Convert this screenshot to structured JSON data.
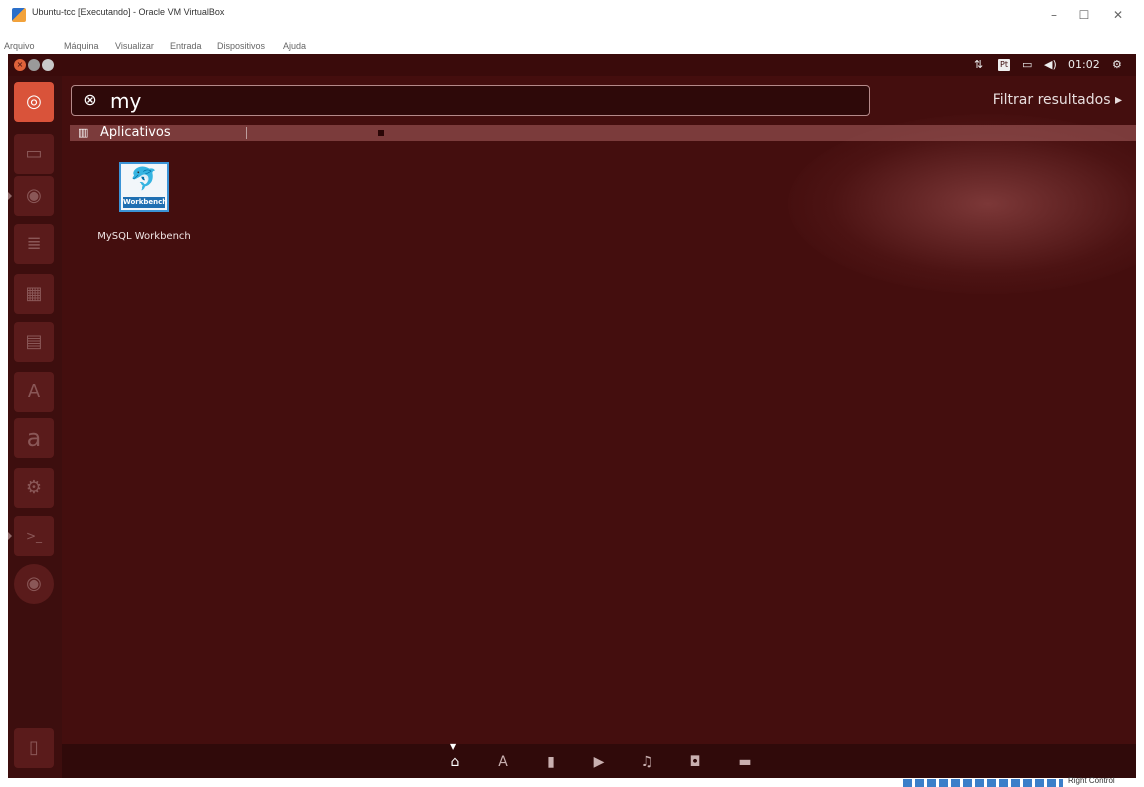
{
  "window": {
    "title": "Ubuntu-tcc [Executando] - Oracle VM VirtualBox",
    "controls": {
      "minimize": "–",
      "maximize": "☐",
      "close": "✕"
    }
  },
  "menu": [
    "Arquivo",
    "Máquina",
    "Visualizar",
    "Entrada",
    "Dispositivos",
    "Ajuda"
  ],
  "top_panel": {
    "keyboard_layout": "Pt",
    "time": "01:02",
    "icons": [
      "network-arrows-icon",
      "keyboard-layout-icon",
      "battery-icon",
      "volume-icon",
      "system-gear-icon"
    ]
  },
  "launcher": {
    "items": [
      {
        "name": "ubuntu-dash-icon",
        "glyph": "◎",
        "active": true
      },
      {
        "name": "files-icon",
        "glyph": "▭"
      },
      {
        "name": "firefox-icon",
        "glyph": "◉"
      },
      {
        "name": "libreoffice-writer-icon",
        "glyph": "≣"
      },
      {
        "name": "libreoffice-calc-icon",
        "glyph": "▦"
      },
      {
        "name": "libreoffice-impress-icon",
        "glyph": "▤"
      },
      {
        "name": "software-center-icon",
        "glyph": "A"
      },
      {
        "name": "amazon-icon",
        "glyph": "a"
      },
      {
        "name": "system-settings-icon",
        "glyph": "⚙"
      },
      {
        "name": "terminal-icon",
        "glyph": ">_"
      },
      {
        "name": "dvd-icon",
        "glyph": "◉"
      },
      {
        "name": "trash-icon",
        "glyph": "▯"
      }
    ]
  },
  "dash": {
    "search_query": "my",
    "clear_glyph": "⊗",
    "filter_label": "Filtrar resultados",
    "filter_arrow": "▸",
    "category": {
      "label": "Aplicativos",
      "icon_glyph": "▥"
    },
    "results": [
      {
        "label": "MySQL Workbench",
        "tile_text": "Workbench",
        "tile_glyph": "🐬"
      }
    ],
    "lenses": [
      {
        "name": "home-lens-icon",
        "glyph": "⌂",
        "active": true
      },
      {
        "name": "applications-lens-icon",
        "glyph": "A"
      },
      {
        "name": "files-lens-icon",
        "glyph": "▮"
      },
      {
        "name": "video-lens-icon",
        "glyph": "▶"
      },
      {
        "name": "music-lens-icon",
        "glyph": "♫"
      },
      {
        "name": "photos-lens-icon",
        "glyph": "◘"
      },
      {
        "name": "social-lens-icon",
        "glyph": "▬"
      }
    ]
  },
  "host_status": {
    "host_key": "Right Control"
  }
}
